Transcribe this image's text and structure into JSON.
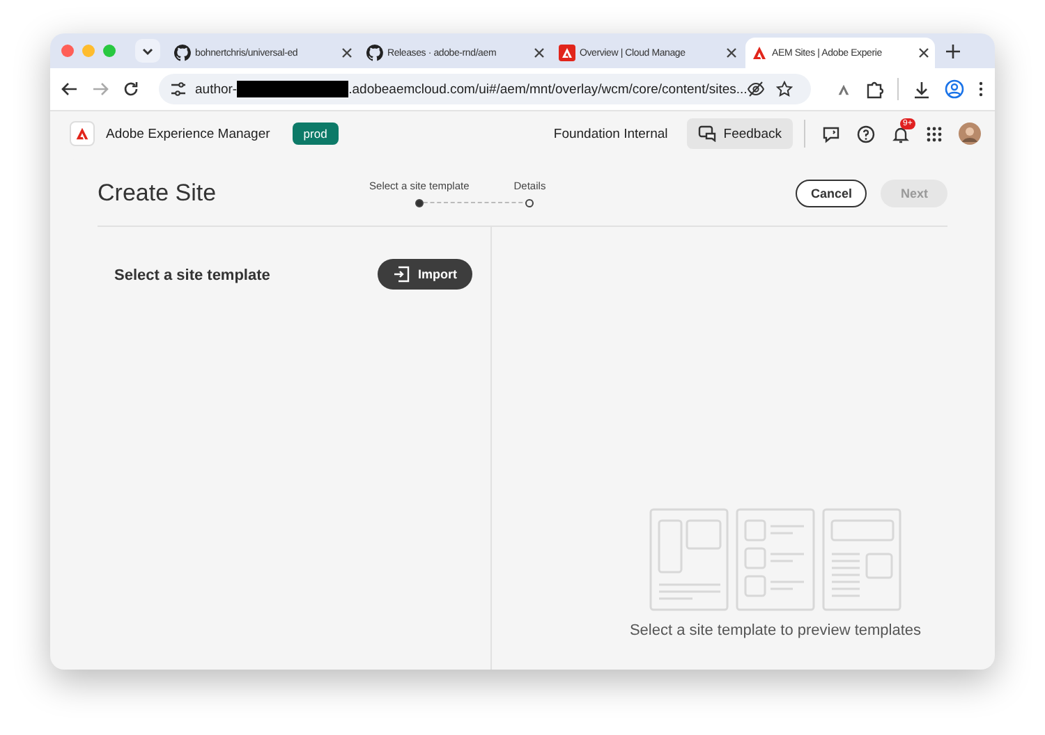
{
  "browser": {
    "tabs": [
      {
        "title": "bohnertchris/universal-ed",
        "selected": false
      },
      {
        "title": "Releases · adobe-rnd/aem",
        "selected": false
      },
      {
        "title": "Overview | Cloud Manage",
        "selected": false
      },
      {
        "title": "AEM Sites | Adobe Experie",
        "selected": true
      }
    ],
    "address": {
      "prefix": "author-",
      "rest": ".adobeaemcloud.com/ui#/aem/mnt/overlay/wcm/core/content/sites..."
    }
  },
  "app": {
    "name": "Adobe Experience Manager",
    "environment": "prod",
    "organization": "Foundation Internal",
    "feedback": "Feedback",
    "notifications": "9+"
  },
  "page": {
    "title": "Create Site",
    "steps": [
      {
        "label": "Select a site template",
        "selected": true
      },
      {
        "label": "Details",
        "selected": false
      }
    ],
    "cancel": "Cancel",
    "next": {
      "label": "Next",
      "disabled": true
    },
    "left_title": "Select a site template",
    "import": "Import",
    "empty_message": "Select a site template to preview templates"
  }
}
